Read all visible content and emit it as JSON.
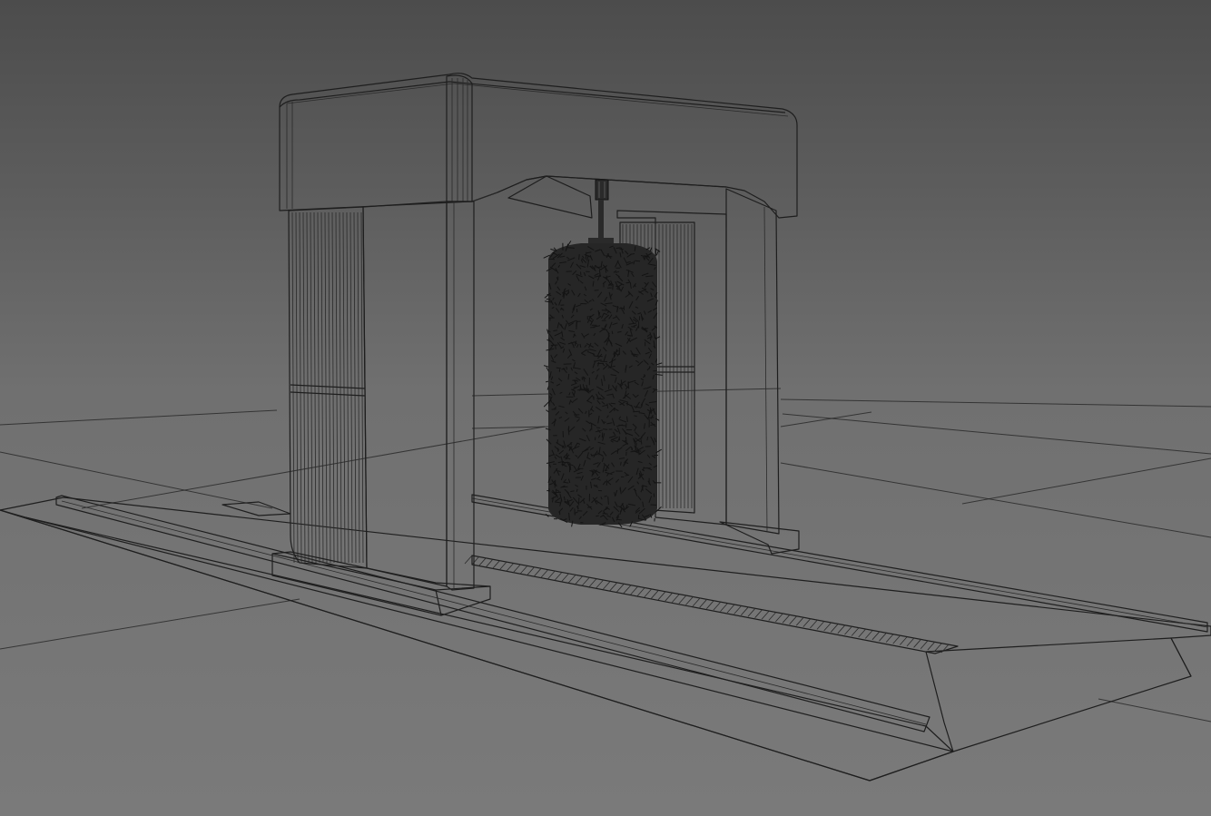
{
  "scene": {
    "subject": "car-wash-gantry-wireframe",
    "colors": {
      "background_top": "#4c4c4c",
      "background_bottom": "#7a7a7a",
      "model_face": "#7c7c7c",
      "model_face_dark": "#6a6a6a",
      "edge": "#1e1e1e",
      "brush": "#262626"
    }
  }
}
